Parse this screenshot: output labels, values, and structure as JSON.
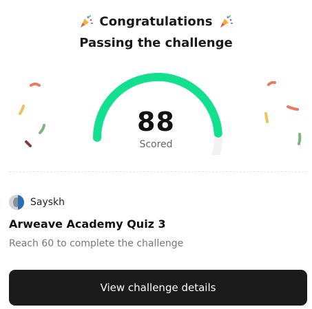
{
  "header": {
    "title": "Congratulations",
    "subtitle": "Passing the challenge"
  },
  "score": {
    "value": "88",
    "label": "Scored",
    "fraction": 0.88
  },
  "colors": {
    "gauge_fill": "#12e08e",
    "gauge_track": "#f2f2f2",
    "button_bg": "#1b1b1b"
  },
  "challenge": {
    "author": "Sayskh",
    "title": "Arweave Academy Quiz 3",
    "description": "Reach 60 to complete the challenge"
  },
  "actions": {
    "details_label": "View challenge details"
  }
}
